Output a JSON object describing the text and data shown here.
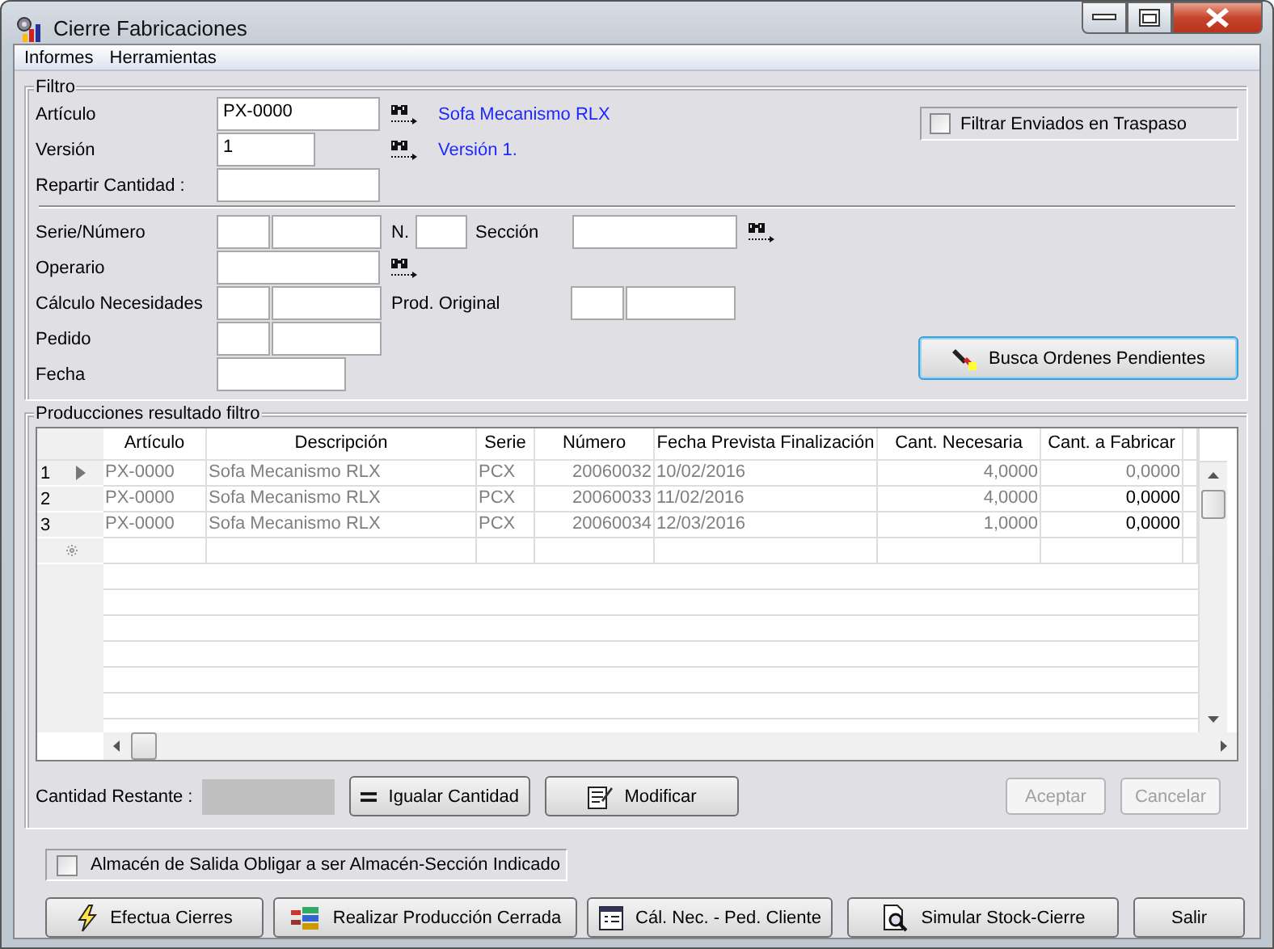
{
  "window": {
    "title": "Cierre Fabricaciones"
  },
  "menu": [
    "Informes",
    "Herramientas"
  ],
  "filter": {
    "title": "Filtro",
    "articulo": {
      "label": "Artículo",
      "value": "PX-0000",
      "description": "Sofa Mecanismo RLX"
    },
    "version": {
      "label": "Versión",
      "value": "1",
      "description": "Versión 1."
    },
    "repartir": {
      "label": "Repartir Cantidad :"
    },
    "filtrar_enviados": {
      "label": "Filtrar Enviados en Traspaso",
      "checked": false
    },
    "serie_numero": {
      "label": "Serie/Número"
    },
    "n": {
      "label": "N."
    },
    "seccion": {
      "label": "Sección"
    },
    "operario": {
      "label": "Operario"
    },
    "calculo": {
      "label": "Cálculo Necesidades"
    },
    "prod_original": {
      "label": "Prod. Original"
    },
    "pedido": {
      "label": "Pedido"
    },
    "fecha": {
      "label": "Fecha"
    },
    "search_button": "Busca Ordenes Pendientes"
  },
  "results": {
    "title": "Producciones resultado filtro",
    "columns": [
      "Artículo",
      "Descripción",
      "Serie",
      "Número",
      "Fecha Prevista Finalización",
      "Cant. Necesaria",
      "Cant. a Fabricar"
    ],
    "rows": [
      {
        "number": "1",
        "current": true,
        "quantity_enabled": false,
        "cells": [
          "PX-0000",
          "Sofa Mecanismo RLX",
          "PCX",
          "20060032",
          "10/02/2016",
          "4,0000",
          "0,0000"
        ]
      },
      {
        "number": "2",
        "current": false,
        "quantity_enabled": true,
        "cells": [
          "PX-0000",
          "Sofa Mecanismo RLX",
          "PCX",
          "20060033",
          "11/02/2016",
          "4,0000",
          "0,0000"
        ]
      },
      {
        "number": "3",
        "current": false,
        "quantity_enabled": true,
        "cells": [
          "PX-0000",
          "Sofa Mecanismo RLX",
          "PCX",
          "20060034",
          "12/03/2016",
          "1,0000",
          "0,0000"
        ]
      }
    ],
    "remaining_label": "Cantidad Restante :",
    "actions": [
      {
        "label": "Igualar Cantidad",
        "kind": "equals",
        "disabled": false
      },
      {
        "label": "Modificar",
        "kind": "notepad",
        "disabled": false
      }
    ],
    "confirm": [
      {
        "label": "Aceptar",
        "disabled": true
      },
      {
        "label": "Cancelar",
        "disabled": true
      }
    ]
  },
  "almacen": {
    "label": "Almacén de Salida Obligar a ser Almacén-Sección Indicado",
    "checked": false
  },
  "buttons": [
    {
      "label": "Efectua Cierres",
      "kind": "bolt"
    },
    {
      "label": "Realizar Producción Cerrada",
      "kind": "blocks"
    },
    {
      "label": "Cál. Nec. - Ped. Cliente",
      "kind": "window"
    },
    {
      "label": "Simular Stock-Cierre",
      "kind": "docsearch"
    },
    {
      "label": "Salir",
      "kind": "plain"
    }
  ]
}
